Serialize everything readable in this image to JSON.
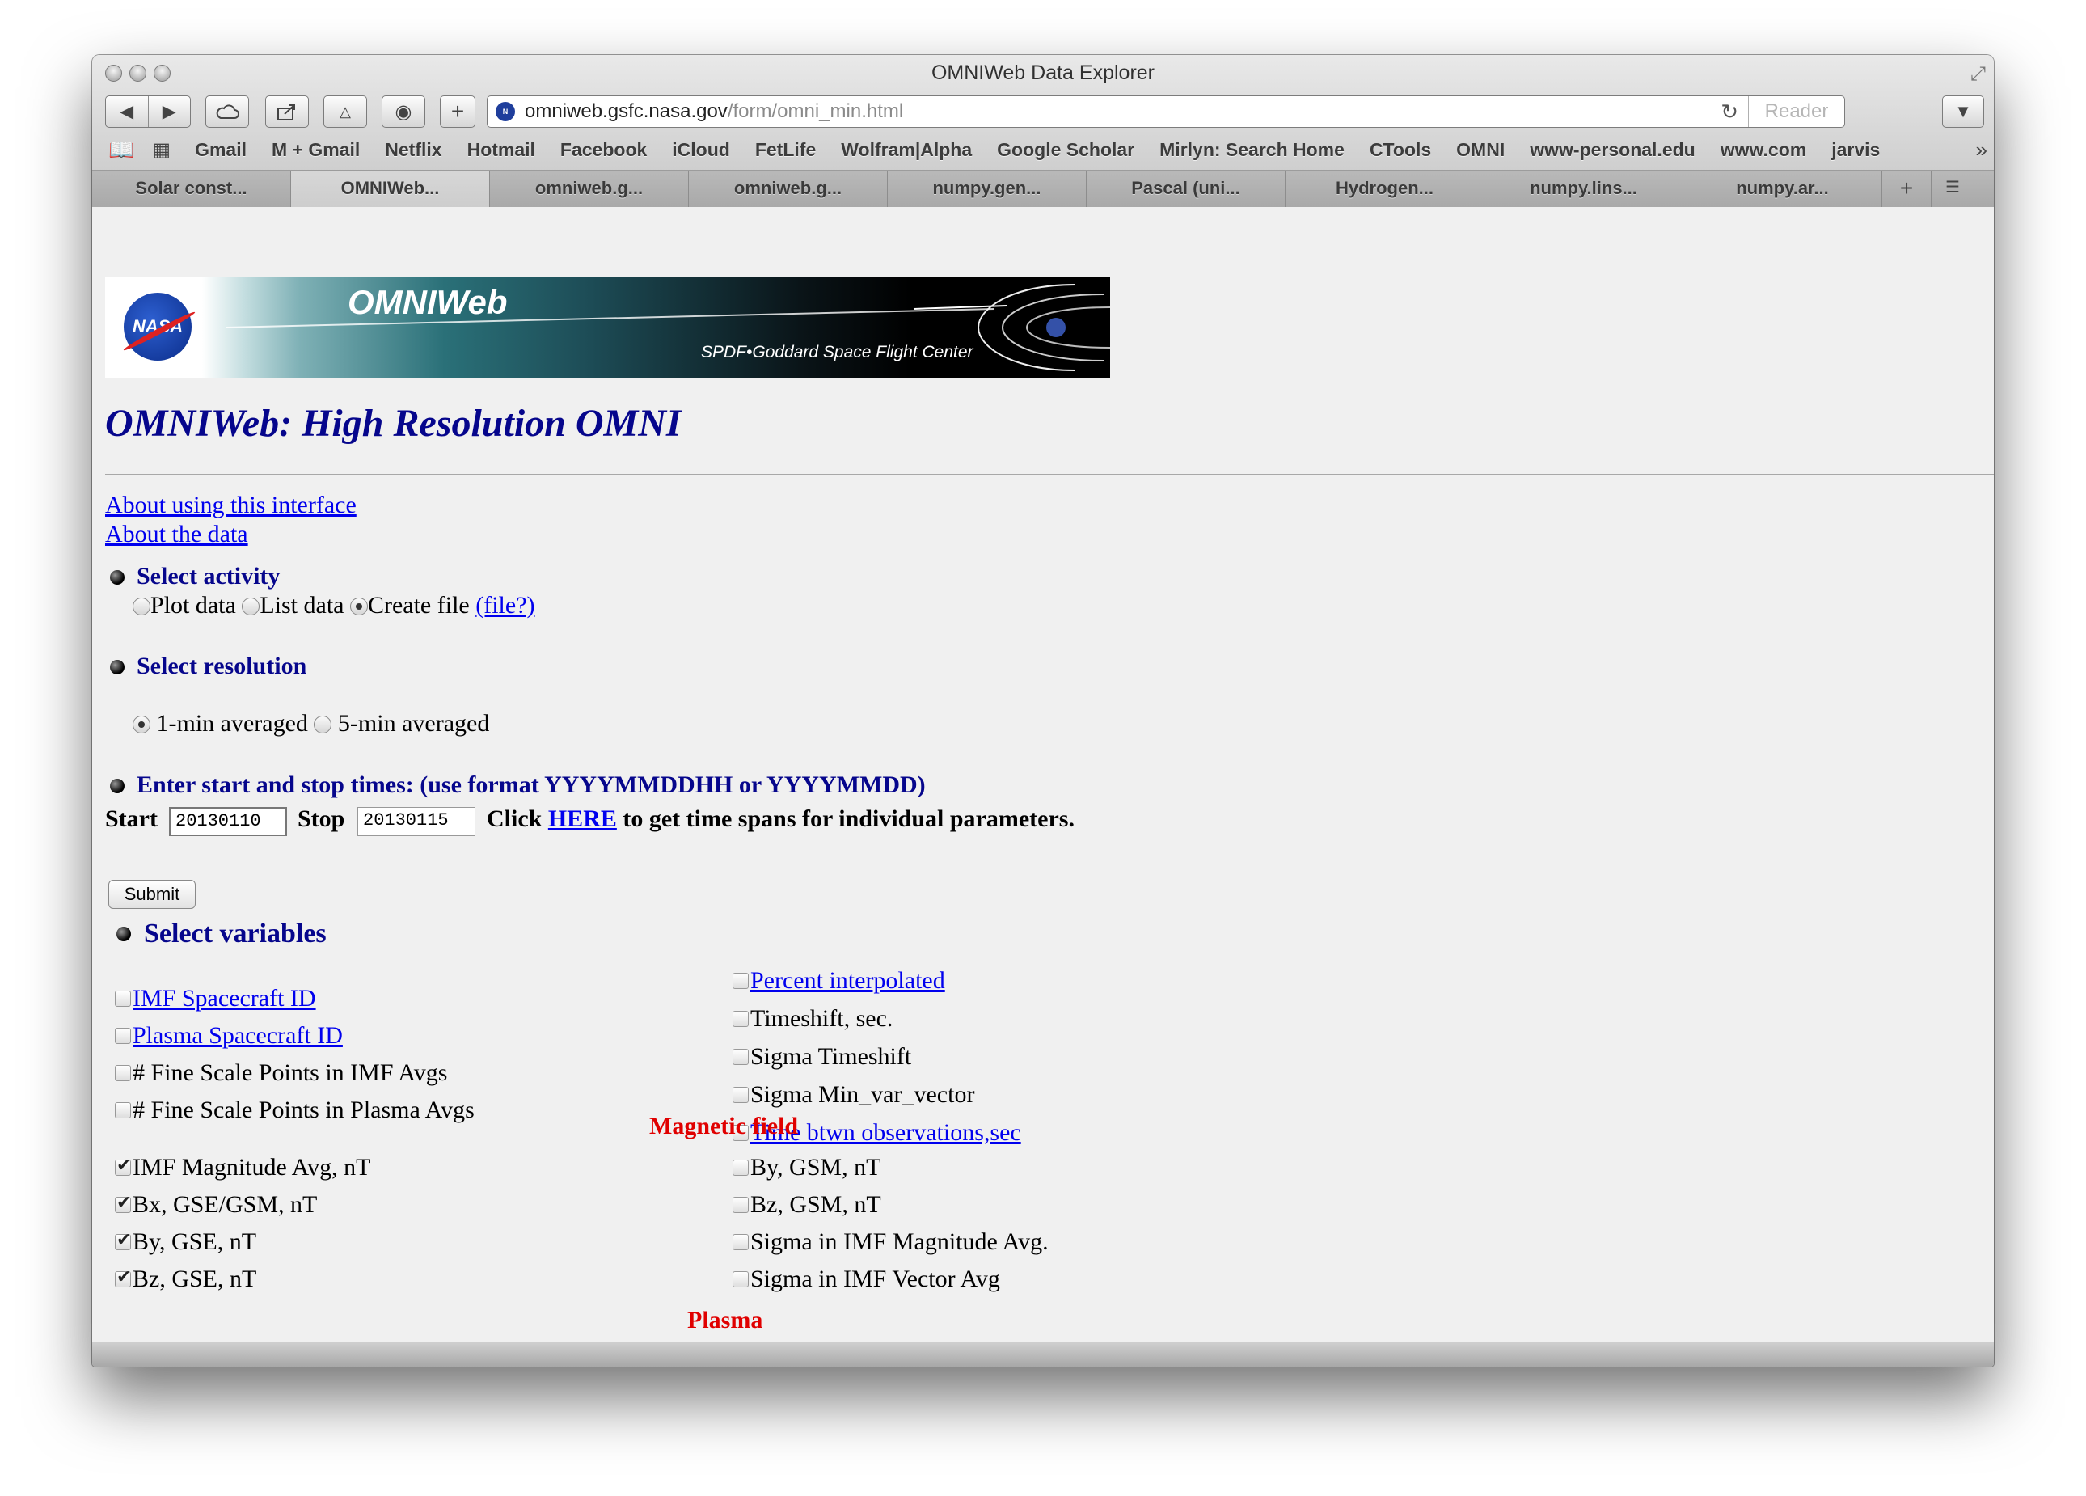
{
  "window": {
    "title": "OMNIWeb Data Explorer"
  },
  "toolbar": {
    "url_host": "omniweb.gsfc.nasa.gov",
    "url_path": "/form/omni_min.html",
    "reader_label": "Reader"
  },
  "bookmarks": [
    "Gmail",
    "M + Gmail",
    "Netflix",
    "Hotmail",
    "Facebook",
    "iCloud",
    "FetLife",
    "Wolfram|Alpha",
    "Google Scholar",
    "Mirlyn: Search Home",
    "CTools",
    "OMNI",
    "www-personal.edu",
    "www.com",
    "jarvis"
  ],
  "tabs": [
    "Solar const...",
    "OMNIWeb...",
    "omniweb.g...",
    "omniweb.g...",
    "numpy.gen...",
    "Pascal (uni...",
    "Hydrogen...",
    "numpy.lins...",
    "numpy.ar..."
  ],
  "active_tab_index": 1,
  "banner": {
    "logo_text": "NASA",
    "title": "OMNIWeb",
    "subtitle": "SPDF•Goddard Space Flight Center"
  },
  "page": {
    "title": "OMNIWeb: High Resolution OMNI",
    "links": [
      "About using this interface ",
      "About the data "
    ],
    "activity": {
      "heading": "Select activity",
      "options": [
        "Plot data",
        "List data",
        "Create file"
      ],
      "selected": "Create file",
      "help_link": "(file?)"
    },
    "resolution": {
      "heading": "Select resolution",
      "options": [
        "1-min averaged",
        "5-min averaged"
      ],
      "selected": "1-min averaged"
    },
    "times": {
      "heading": "Enter start and stop times: (use format YYYYMMDDHH or YYYYMMDD)",
      "start_label": "Start",
      "start_value": "20130110",
      "stop_label": "Stop",
      "stop_value": "20130115",
      "click_text": "Click",
      "here_link": "HERE",
      "tail_text": "to get time spans for individual parameters."
    },
    "submit_label": "Submit",
    "variables": {
      "heading": "Select variables",
      "general_left": [
        {
          "label": "IMF Spacecraft ID",
          "link": true,
          "checked": false
        },
        {
          "label": "Plasma Spacecraft ID",
          "link": true,
          "checked": false
        },
        {
          "label": "# Fine Scale Points in IMF Avgs",
          "link": false,
          "checked": false
        },
        {
          "label": "# Fine Scale Points in Plasma Avgs",
          "link": false,
          "checked": false
        }
      ],
      "general_right": [
        {
          "label": "Percent interpolated",
          "link": true,
          "checked": false
        },
        {
          "label": "Timeshift, sec.",
          "link": false,
          "checked": false
        },
        {
          "label": "Sigma Timeshift",
          "link": false,
          "checked": false
        },
        {
          "label": "Sigma Min_var_vector",
          "link": false,
          "checked": false
        },
        {
          "label": "Time btwn observations,sec",
          "link": true,
          "checked": false
        }
      ],
      "magnetic_heading": "Magnetic field",
      "magnetic_left": [
        {
          "label": "IMF Magnitude Avg, nT",
          "checked": true
        },
        {
          "label": "Bx, GSE/GSM, nT",
          "checked": true
        },
        {
          "label": "By, GSE, nT",
          "checked": true
        },
        {
          "label": "Bz, GSE, nT",
          "checked": true
        }
      ],
      "magnetic_right": [
        {
          "label": "By, GSM, nT",
          "checked": false
        },
        {
          "label": "Bz, GSM, nT",
          "checked": false
        },
        {
          "label": "Sigma in IMF Magnitude Avg.",
          "checked": false
        },
        {
          "label": "Sigma in IMF Vector Avg",
          "checked": false
        }
      ],
      "plasma_heading": "Plasma"
    }
  }
}
